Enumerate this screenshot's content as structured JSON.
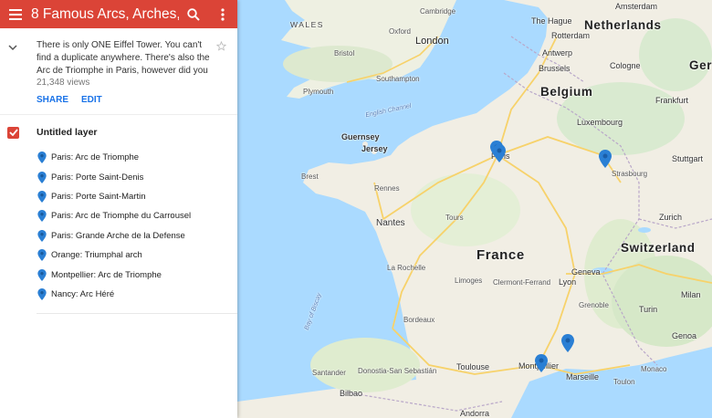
{
  "header": {
    "title": "8 Famous Arcs, Arches,...",
    "menu_icon": "hamburger-menu-icon",
    "search_icon": "search-icon",
    "more_icon": "more-vert-icon",
    "bar_color": "#db4437"
  },
  "description": {
    "text": "There is only ONE Eiffel Tower. You can't find a duplicate anywhere. There's also the Arc de Triomphe in Paris, however did you",
    "views": "21,348 views",
    "share_label": "SHARE",
    "edit_label": "EDIT"
  },
  "layer": {
    "name": "Untitled layer",
    "checked": true,
    "places": [
      {
        "name": "Paris: Arc de Triomphe"
      },
      {
        "name": "Paris: Porte Saint-Denis"
      },
      {
        "name": "Paris: Porte Saint-Martin"
      },
      {
        "name": "Paris: Arc de Triomphe du Carrousel"
      },
      {
        "name": "Paris: Grande Arche de la Defense"
      },
      {
        "name": "Orange: Triumphal arch"
      },
      {
        "name": "Montpellier: Arc de Triomphe"
      },
      {
        "name": "Nancy: Arc Héré"
      }
    ]
  },
  "map": {
    "marker_color": "#2a7fd4",
    "labels": {
      "wales": "WALES",
      "cambridge": "Cambridge",
      "oxford": "Oxford",
      "london": "London",
      "bristol": "Bristol",
      "southampton": "Southampton",
      "plymouth": "Plymouth",
      "english_channel": "English Channel",
      "guernsey": "Guernsey",
      "jersey": "Jersey",
      "the_hague": "The Hague",
      "netherlands": "Netherlands",
      "amsterdam": "Amsterdam",
      "rotterdam": "Rotterdam",
      "antwerp": "Antwerp",
      "brussels": "Brussels",
      "cologne": "Cologne",
      "belgium": "Belgium",
      "germany": "Ger",
      "frankfurt": "Frankfurt",
      "luxembourg": "Luxembourg",
      "stuttgart": "Stuttgart",
      "strasbourg": "Strasbourg",
      "paris": "Paris",
      "brest": "Brest",
      "rennes": "Rennes",
      "tours": "Tours",
      "nantes": "Nantes",
      "france": "France",
      "zurich": "Zurich",
      "switzerland": "Switzerland",
      "la_rochelle": "La Rochelle",
      "limoges": "Limoges",
      "clermont_ferrand": "Clermont-Ferrand",
      "geneva": "Geneva",
      "lyon": "Lyon",
      "milan": "Milan",
      "turin": "Turin",
      "grenoble": "Grenoble",
      "bay_of_biscay": "Bay of Biscay",
      "bordeaux": "Bordeaux",
      "genoa": "Genoa",
      "toulouse": "Toulouse",
      "montpellier": "Montpellier",
      "marseille": "Marseille",
      "monaco": "Monaco",
      "toulon": "Toulon",
      "santander": "Santander",
      "donostia": "Donostia-San Sebastián",
      "bilbao": "Bilbao",
      "andorra": "Andorra"
    }
  }
}
